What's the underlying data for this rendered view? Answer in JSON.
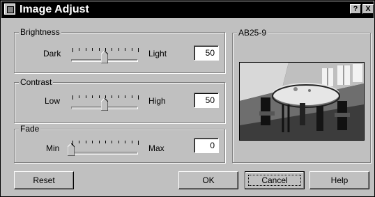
{
  "window": {
    "title": "Image Adjust",
    "help_glyph": "?",
    "close_glyph": "X"
  },
  "brightness": {
    "label": "Brightness",
    "min_label": "Dark",
    "max_label": "Light",
    "value": "50",
    "level": 0.5
  },
  "contrast": {
    "label": "Contrast",
    "min_label": "Low",
    "max_label": "High",
    "value": "50",
    "level": 0.5
  },
  "fade": {
    "label": "Fade",
    "min_label": "Min",
    "max_label": "Max",
    "value": "0",
    "level": 0.0
  },
  "preview": {
    "label": "AB25-9"
  },
  "buttons": {
    "reset": "Reset",
    "ok": "OK",
    "cancel": "Cancel",
    "help": "Help"
  }
}
